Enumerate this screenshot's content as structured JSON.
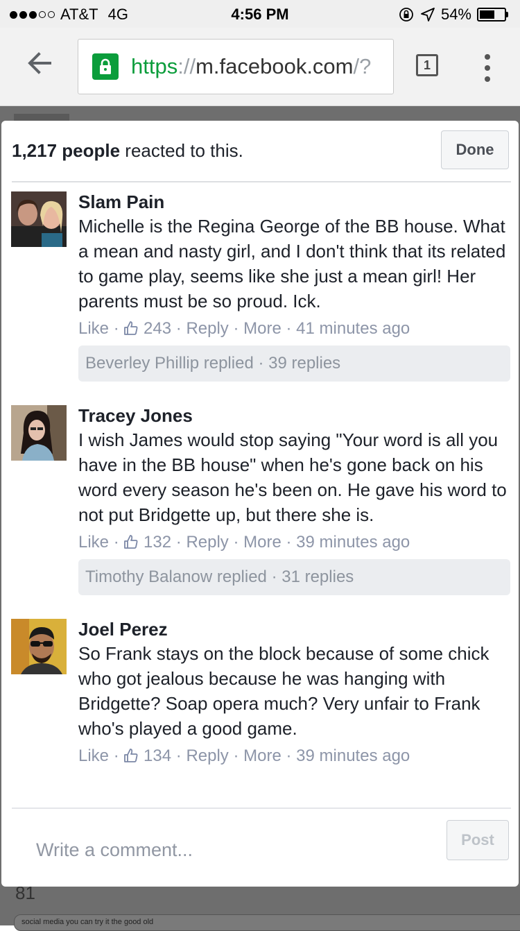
{
  "status_bar": {
    "carrier": "AT&T",
    "network": "4G",
    "time": "4:56 PM",
    "battery": "54%",
    "battery_level": 0.54
  },
  "browser": {
    "url_scheme": "https",
    "url_separator": "://",
    "url_host": "m.facebook.com",
    "url_rest": "/?",
    "tab_count": "1"
  },
  "modal": {
    "reaction_count": "1,217 people",
    "reaction_suffix": " reacted to this.",
    "done_label": "Done",
    "comments": [
      {
        "author": "Slam Pain",
        "text": "Michelle is the Regina George of the BB house. What a mean and nasty girl, and I don't think that its related to game play, seems like she just a mean girl! Her parents must be so proud. Ick.",
        "like": "Like",
        "likes": "243",
        "reply": "Reply",
        "more": "More",
        "time": "41 minutes ago",
        "replies": "Beverley Phillip replied · 39 replies"
      },
      {
        "author": "Tracey Jones",
        "text": "I wish James would stop saying \"Your word is all you have in the BB house\" when he's gone back on his word every season he's been on. He gave his word to not put Bridgette up, but there she is.",
        "like": "Like",
        "likes": "132",
        "reply": "Reply",
        "more": "More",
        "time": "39 minutes ago",
        "replies": "Timothy Balanow replied · 31 replies"
      },
      {
        "author": "Joel Perez",
        "text": "So Frank stays on the block because of some chick who got jealous because he was hanging with Bridgette? Soap opera much? Very unfair to Frank who's played a good game.",
        "like": "Like",
        "likes": "134",
        "reply": "Reply",
        "more": "More",
        "time": "39 minutes ago"
      }
    ],
    "composer_placeholder": "Write a comment...",
    "post_label": "Post"
  },
  "background": {
    "number": "81",
    "caption": "social media you can try it the good old"
  }
}
